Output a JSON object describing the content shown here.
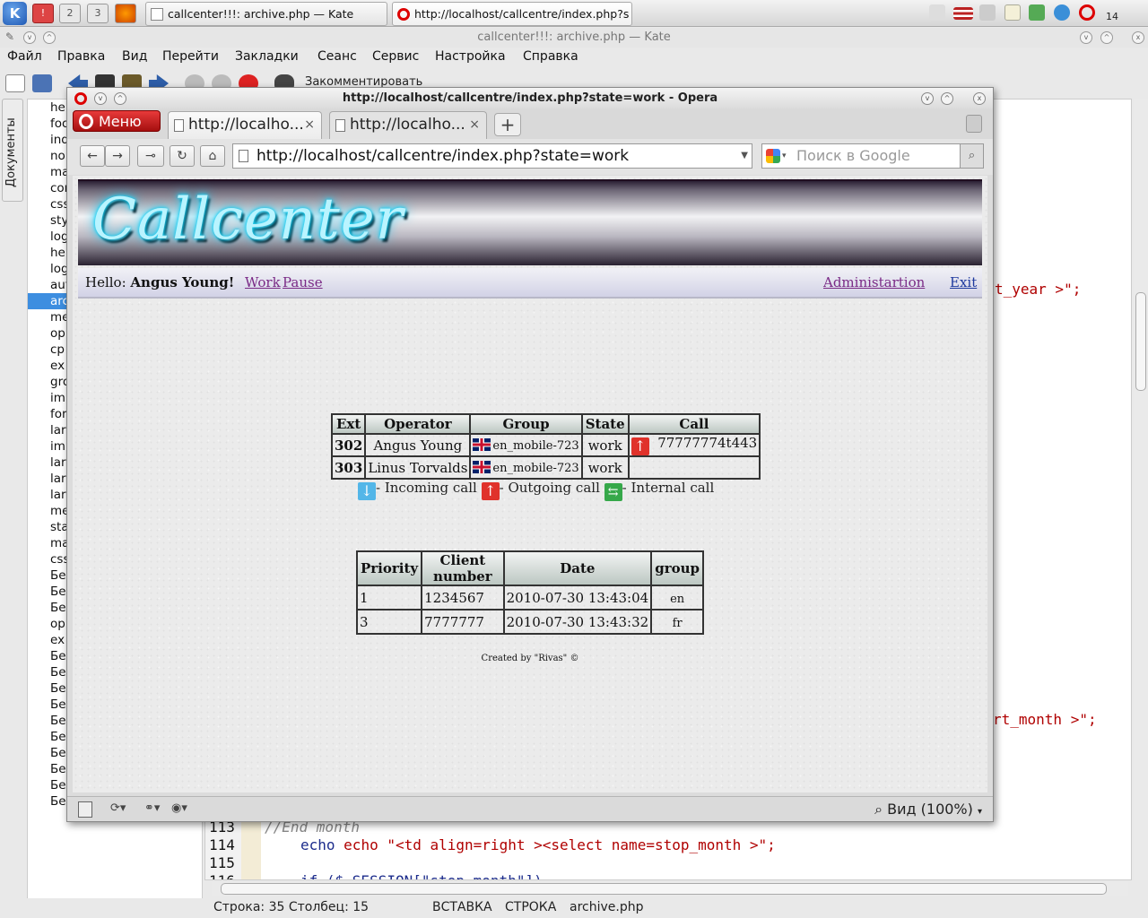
{
  "taskbar": {
    "desktop_buttons": [
      "2",
      "3"
    ],
    "tasks": [
      {
        "label": "callcenter!!!: archive.php — Kate"
      },
      {
        "label": "http://localhost/callcentre/index.php?s"
      }
    ],
    "clock": "14"
  },
  "kate": {
    "title": "callcenter!!!: archive.php — Kate",
    "menu": [
      "Файл",
      "Правка",
      "Вид",
      "Перейти",
      "Закладки",
      "Сеанс",
      "Сервис",
      "Настройка",
      "Справка"
    ],
    "toolbar_label": "Закомментировать",
    "side_tab": "Документы",
    "doc_list": [
      "he",
      "foo",
      "ind",
      "no",
      "ma",
      "cor",
      "css",
      "sty",
      "log",
      "he",
      "log",
      "aut",
      "arc",
      "me",
      "op",
      "cp",
      "ex",
      "gro",
      "im",
      "for",
      "lar",
      "im",
      "lar",
      "lar",
      "lar",
      "me",
      "sta",
      "ma",
      "css",
      "Бе",
      "Бе",
      "Бе",
      "op",
      "ex",
      "Бе",
      "Бе",
      "Бе",
      "Бе",
      "Бе",
      "Бе",
      "Бе",
      "Бе",
      "Бе",
      "Бе"
    ],
    "selected_doc_index": 12,
    "code_right_1": "t_year >\";",
    "code_right_2": "rt_month >\";",
    "lines": [
      {
        "num": "113",
        "text": "//End month"
      },
      {
        "num": "114",
        "text": "echo \"<td align=right ><select name=stop_month >\";"
      },
      {
        "num": "115",
        "text": ""
      },
      {
        "num": "116",
        "text": "if ($_SESSION[\"stop_month\"])"
      }
    ],
    "status": {
      "position": "Строка: 35 Столбец: 15",
      "mode": "ВСТАВКА",
      "sel_mode": "СТРОКА",
      "file": "archive.php"
    }
  },
  "opera": {
    "title": "http://localhost/callcentre/index.php?state=work - Opera",
    "menu_label": "Меню",
    "tabs": [
      {
        "label": "http://localho..."
      },
      {
        "label": "http://localho..."
      }
    ],
    "url": "http://localhost/callcentre/index.php?state=work",
    "search_placeholder": "Поиск в Google",
    "zoom_label": "Вид (100%)"
  },
  "page": {
    "logo_text": "Callcenter",
    "hello_label": "Hello:",
    "user_name": "Angus Young!",
    "links": {
      "work": "Work",
      "pause": "Pause",
      "admin": "Administartion",
      "exit": "Exit"
    },
    "operators": {
      "headers": [
        "Ext",
        "Operator",
        "Group",
        "State",
        "Call"
      ],
      "rows": [
        {
          "ext": "302",
          "operator": "Angus Young",
          "group": "en_mobile-723",
          "state": "work",
          "call": "77777774t443",
          "call_type": "outgoing"
        },
        {
          "ext": "303",
          "operator": "Linus Torvalds",
          "group": "en_mobile-723",
          "state": "work",
          "call": "",
          "call_type": ""
        }
      ]
    },
    "legend": {
      "incoming": "- Incoming call",
      "outgoing": "- Outgoing call",
      "internal": "- Internal call"
    },
    "queue": {
      "headers": [
        "Priority",
        "Client number",
        "Date",
        "group"
      ],
      "rows": [
        {
          "priority": "1",
          "client": "1234567",
          "date": "2010-07-30 13:43:04",
          "group": "en"
        },
        {
          "priority": "3",
          "client": "7777777",
          "date": "2010-07-30 13:43:32",
          "group": "fr"
        }
      ]
    },
    "footer": "Created by \"Rivas\" ©"
  }
}
